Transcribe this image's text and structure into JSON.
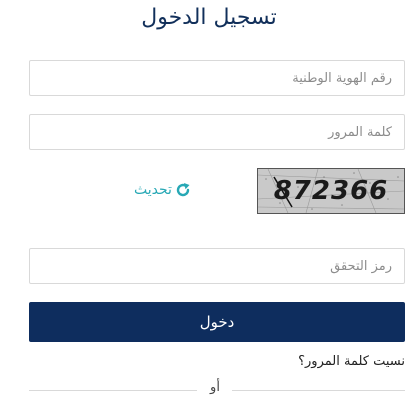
{
  "title": "تسجيل الدخول",
  "form": {
    "national_id_placeholder": "رقم الهوية الوطنية",
    "password_placeholder": "كلمة المرور",
    "captcha_text": "872366",
    "refresh_label": "تحديث",
    "verification_code_placeholder": "رمز التحقق",
    "submit_label": "دخول",
    "forgot_password": "نسيت كلمة المرور؟",
    "or_label": "أو"
  },
  "colors": {
    "primary": "#0e2d5e",
    "title": "#112f5a",
    "link_accent": "#27a8b5",
    "border": "#d9d9d9"
  },
  "icons": {
    "refresh": "refresh-icon"
  }
}
